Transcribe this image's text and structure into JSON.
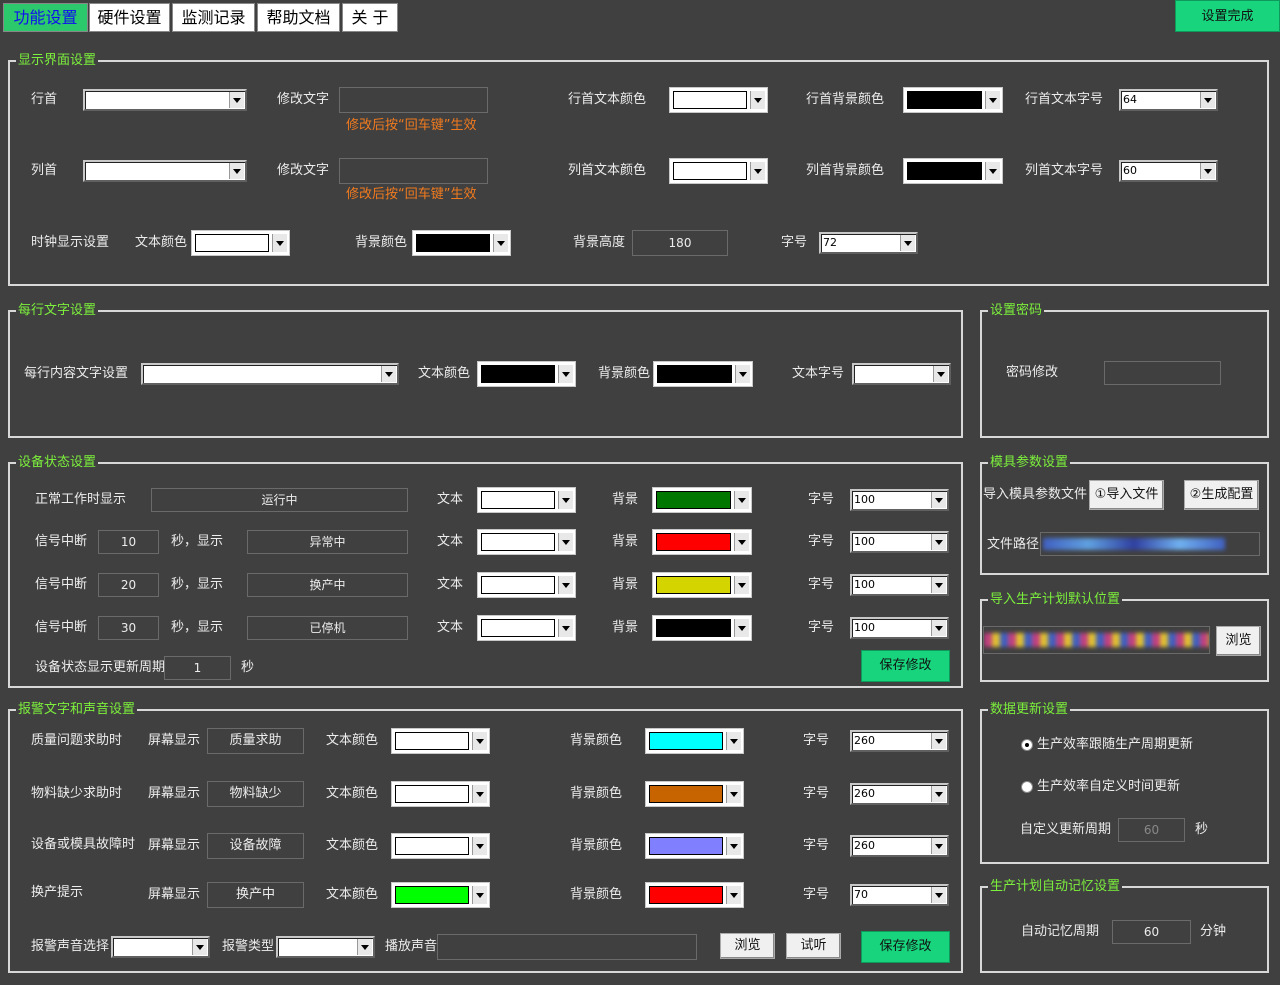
{
  "tabs": [
    "功能设置",
    "硬件设置",
    "监测记录",
    "帮助文档",
    "关 于"
  ],
  "done_button": "设置完成",
  "display": {
    "title": "显示界面设置",
    "row_head_label": "行首",
    "col_head_label": "列首",
    "modify_text_label": "修改文字",
    "enter_hint": "修改后按“回车键”生效",
    "row_text_color_label": "行首文本颜色",
    "row_bg_color_label": "行首背景颜色",
    "row_font_label": "行首文本字号",
    "row_font_value": "64",
    "col_text_color_label": "列首文本颜色",
    "col_bg_color_label": "列首背景颜色",
    "col_font_label": "列首文本字号",
    "col_font_value": "60",
    "clock_label": "时钟显示设置",
    "clock_text_color_label": "文本颜色",
    "clock_bg_color_label": "背景颜色",
    "clock_bg_height_label": "背景高度",
    "clock_bg_height_value": "180",
    "clock_font_label": "字号",
    "clock_font_value": "72"
  },
  "line_text": {
    "title": "每行文字设置",
    "content_label": "每行内容文字设置",
    "text_color_label": "文本颜色",
    "bg_color_label": "背景颜色",
    "font_label": "文本字号"
  },
  "password": {
    "title": "设置密码",
    "label": "密码修改"
  },
  "status": {
    "title": "设备状态设置",
    "normal_label": "正常工作时显示",
    "normal_value": "运行中",
    "signal_label": "信号中断",
    "sec_show": "秒，显示",
    "text_label": "文本",
    "bg_label": "背景",
    "font_label": "字号",
    "rows": [
      {
        "seconds": "10",
        "display": "异常中",
        "bg": "#ff0000",
        "font": "100"
      },
      {
        "seconds": "20",
        "display": "换产中",
        "bg": "#d4d400",
        "font": "100"
      },
      {
        "seconds": "30",
        "display": "已停机",
        "bg": "#000000",
        "font": "100"
      }
    ],
    "normal_bg": "#007800",
    "normal_font": "100",
    "period_label": "设备状态显示更新周期",
    "period_value": "1",
    "period_unit": "秒",
    "save": "保存修改"
  },
  "mold": {
    "title": "模具参数设置",
    "import_label": "导入模具参数文件",
    "import_btn": "①导入文件",
    "gen_btn": "②生成配置",
    "path_label": "文件路径"
  },
  "plan_import": {
    "title": "导入生产计划默认位置",
    "browse": "浏览"
  },
  "alarm": {
    "title": "报警文字和声音设置",
    "screen_label": "屏幕显示",
    "text_color_label": "文本颜色",
    "bg_color_label": "背景颜色",
    "font_label": "字号",
    "rows": [
      {
        "name": "质量问题求助时",
        "display": "质量求助",
        "text_color": "#ffffff",
        "bg": "#00ffff",
        "font": "260"
      },
      {
        "name": "物料缺少求助时",
        "display": "物料缺少",
        "text_color": "#ffffff",
        "bg": "#c86400",
        "font": "260"
      },
      {
        "name": "设备或模具故障时",
        "display": "设备故障",
        "text_color": "#ffffff",
        "bg": "#8080ff",
        "font": "260"
      },
      {
        "name": "换产提示",
        "display": "换产中",
        "text_color": "#00ff00",
        "bg": "#ff0000",
        "font": "70"
      }
    ],
    "sound_select_label": "报警声音选择",
    "alarm_type_label": "报警类型",
    "play_label": "播放声音",
    "browse": "浏览",
    "listen": "试听",
    "save": "保存修改"
  },
  "data_update": {
    "title": "数据更新设置",
    "opt1": "生产效率跟随生产周期更新",
    "opt2": "生产效率自定义时间更新",
    "custom_label": "自定义更新周期",
    "custom_value": "60",
    "custom_unit": "秒"
  },
  "memory": {
    "title": "生产计划自动记忆设置",
    "label": "自动记忆周期",
    "value": "60",
    "unit": "分钟"
  }
}
